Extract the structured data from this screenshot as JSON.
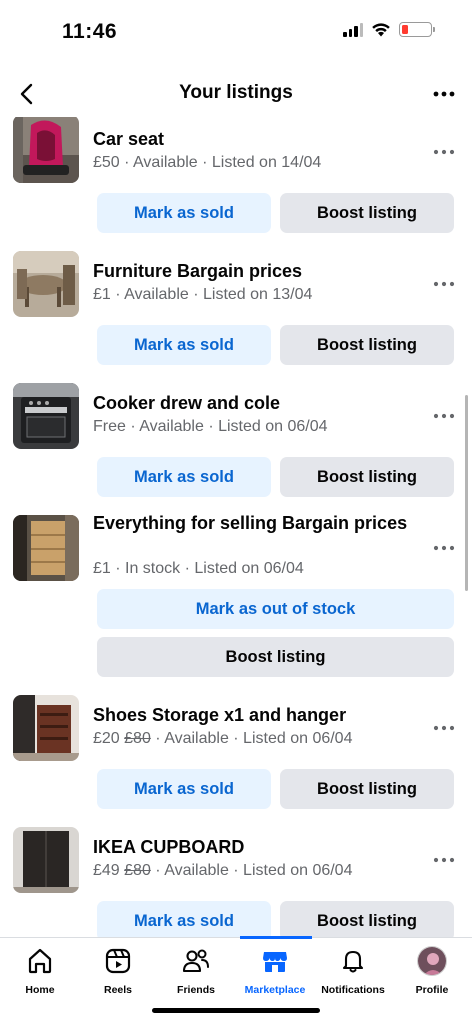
{
  "status_bar": {
    "time": "11:46"
  },
  "header": {
    "title": "Your listings"
  },
  "listings": [
    {
      "title": "Car seat",
      "price": "£50",
      "old_price": "",
      "status_text": " · Available · Listed on 14/04",
      "sold_label": "Mark as sold",
      "boost_label": "Boost listing"
    },
    {
      "title": "Furniture Bargain prices",
      "price": "£1",
      "old_price": "",
      "status_text": " · Available · Listed on 13/04",
      "sold_label": "Mark as sold",
      "boost_label": "Boost listing"
    },
    {
      "title": "Cooker drew and cole",
      "price": "Free",
      "old_price": "",
      "status_text": " · Available · Listed on 06/04",
      "sold_label": "Mark as sold",
      "boost_label": "Boost listing"
    },
    {
      "title": "Everything for selling Bargain prices",
      "price": "£1",
      "old_price": "",
      "status_text": " · In stock · Listed on 06/04",
      "sold_label": "Mark as out of stock",
      "boost_label": "Boost listing"
    },
    {
      "title": "Shoes Storage x1 and hanger",
      "price": "£20",
      "old_price": "£80",
      "status_text": " · Available · Listed on 06/04",
      "sold_label": "Mark as sold",
      "boost_label": "Boost listing"
    },
    {
      "title": "IKEA CUPBOARD",
      "price": "£49",
      "old_price": "£80",
      "status_text": " · Available · Listed on 06/04",
      "sold_label": "Mark as sold",
      "boost_label": "Boost listing"
    }
  ],
  "tabs": [
    {
      "label": "Home",
      "icon": "home-icon"
    },
    {
      "label": "Reels",
      "icon": "reels-icon"
    },
    {
      "label": "Friends",
      "icon": "friends-icon"
    },
    {
      "label": "Marketplace",
      "icon": "marketplace-icon",
      "active": true
    },
    {
      "label": "Notifications",
      "icon": "bell-icon"
    },
    {
      "label": "Profile",
      "icon": "avatar"
    }
  ],
  "colors": {
    "accent": "#0866ff",
    "link_blue": "#0a66d0",
    "button_blue_bg": "#e7f3ff",
    "button_grey_bg": "#e4e6eb",
    "meta_grey": "#65676b"
  }
}
